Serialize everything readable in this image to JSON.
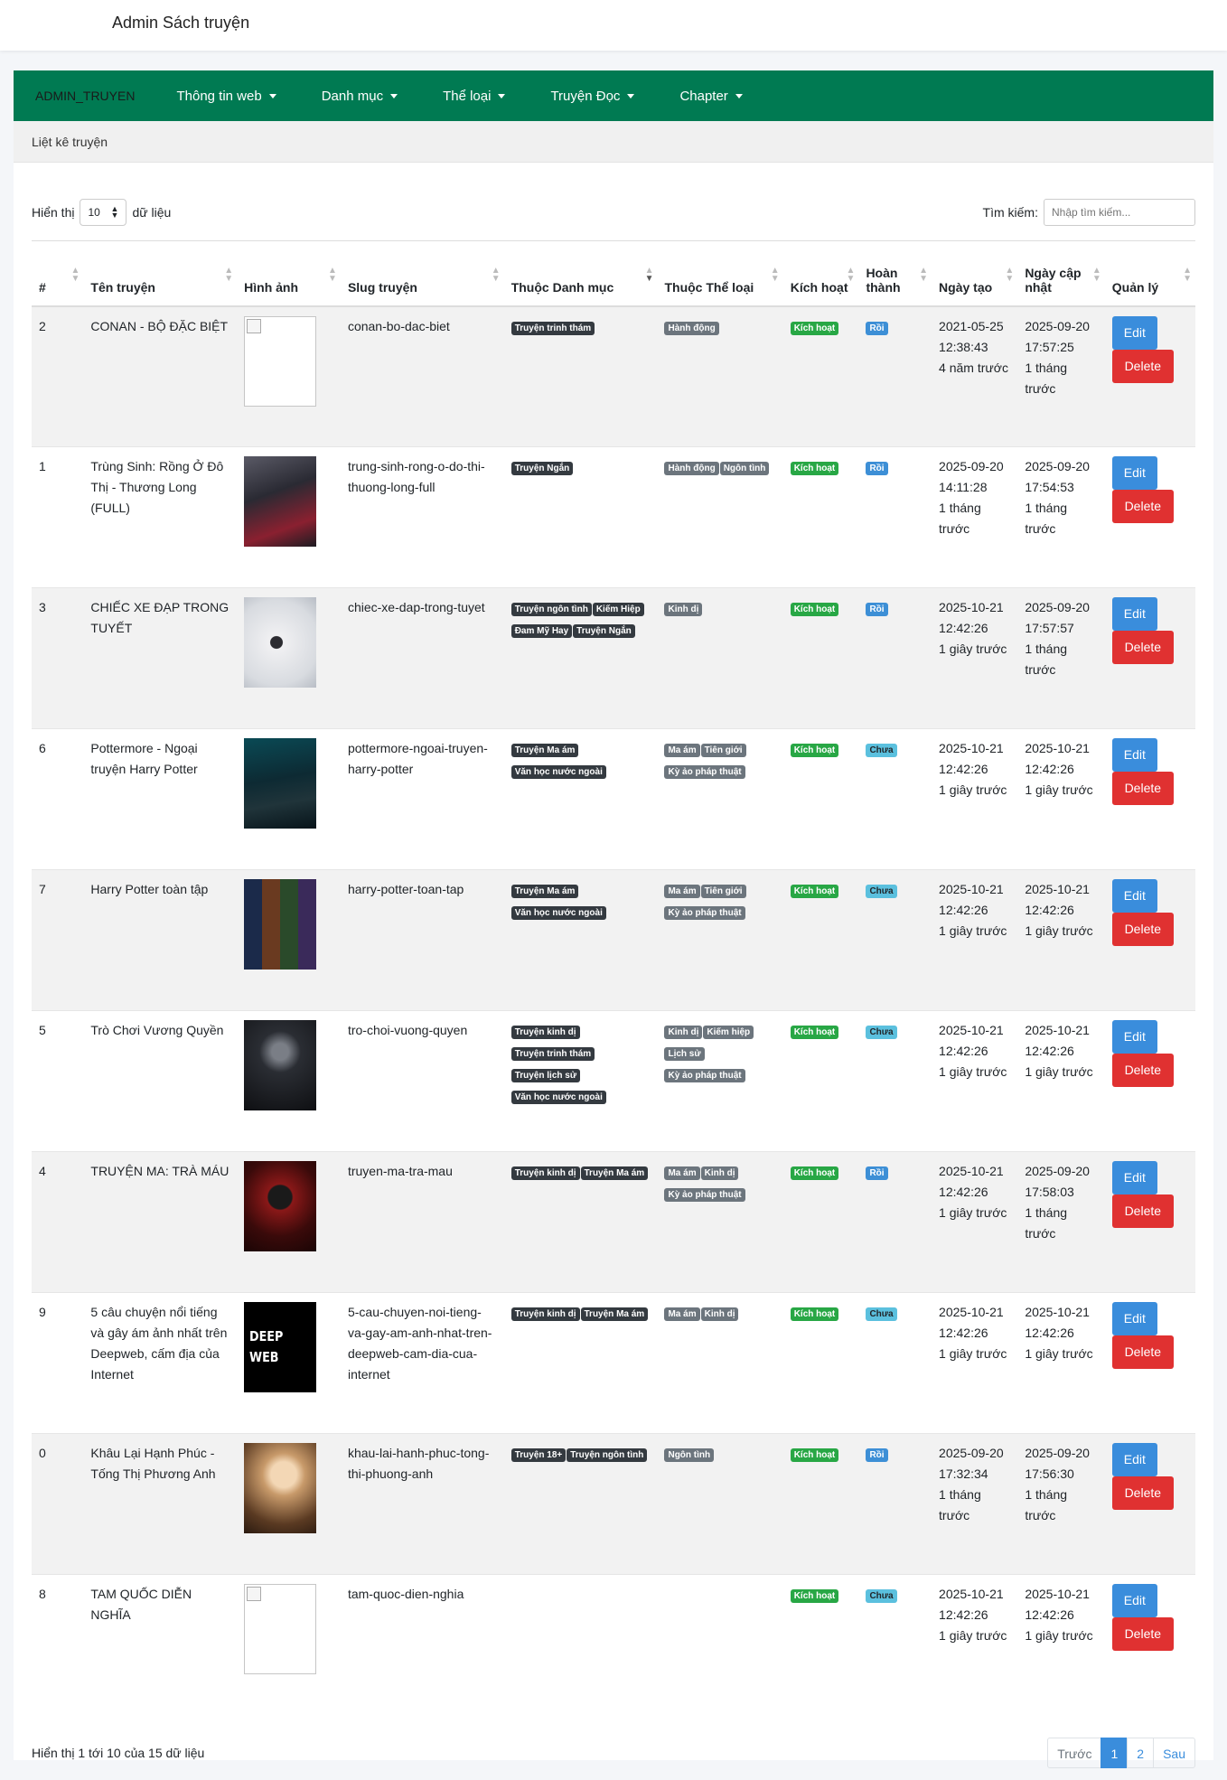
{
  "app": {
    "title": "Admin Sách truyện"
  },
  "nav": {
    "brand": "ADMIN_TRUYEN",
    "items": [
      "Thông tin web",
      "Danh mục",
      "Thể loại",
      "Truyện Đọc",
      "Chapter"
    ]
  },
  "breadcrumb": "Liệt kê truyện",
  "controls": {
    "show_prefix": "Hiển thị",
    "page_size": "10",
    "show_suffix": "dữ liệu",
    "search_label": "Tìm kiếm:",
    "search_placeholder": "Nhập tìm kiếm..."
  },
  "table": {
    "headers": [
      "#",
      "Tên truyện",
      "Hình ảnh",
      "Slug truyện",
      "Thuộc Danh mục",
      "Thuộc Thể loại",
      "Kích hoạt",
      "Hoàn thành",
      "Ngày tạo",
      "Ngày cập nhật",
      "Quản lý"
    ],
    "edit_label": "Edit",
    "delete_label": "Delete",
    "rows": [
      {
        "id": "2",
        "name": "CONAN - BỘ ĐẶC BIỆT",
        "image": "broken",
        "slug": "conan-bo-dac-biet",
        "categories": [
          "Truyện trinh thám"
        ],
        "genres": [
          "Hành động"
        ],
        "active": "Kích hoạt",
        "done": "Rồi",
        "created": "2021-05-25 12:38:43",
        "created_ago": "4 năm trước",
        "updated": "2025-09-20 17:57:25",
        "updated_ago": "1 tháng trước"
      },
      {
        "id": "1",
        "name": "Trùng Sinh: Rồng Ở Đô Thị - Thương Long (FULL)",
        "image": "dark-poster",
        "slug": "trung-sinh-rong-o-do-thi-thuong-long-full",
        "categories": [
          "Truyện Ngắn"
        ],
        "genres": [
          "Hành động",
          "Ngôn tình"
        ],
        "active": "Kích hoạt",
        "done": "Rồi",
        "created": "2025-09-20 14:11:28",
        "created_ago": "1 tháng trước",
        "updated": "2025-09-20 17:54:53",
        "updated_ago": "1 tháng trước"
      },
      {
        "id": "3",
        "name": "CHIẾC XE ĐẠP TRONG TUYẾT",
        "image": "snow-bike",
        "slug": "chiec-xe-dap-trong-tuyet",
        "categories": [
          "Truyện ngôn tình",
          "Kiếm Hiệp",
          "Đam Mỹ Hay",
          "Truyện Ngắn"
        ],
        "genres": [
          "Kinh dị"
        ],
        "active": "Kích hoạt",
        "done": "Rồi",
        "created": "2025-10-21 12:42:26",
        "created_ago": "1 giây trước",
        "updated": "2025-09-20 17:57:57",
        "updated_ago": "1 tháng trước"
      },
      {
        "id": "6",
        "name": "Pottermore - Ngoại truyện Harry Potter",
        "image": "teal-poster",
        "slug": "pottermore-ngoai-truyen-harry-potter",
        "categories": [
          "Truyện Ma ám",
          "Văn học nước ngoài"
        ],
        "genres": [
          "Ma ám",
          "Tiên giới",
          "Kỳ ảo pháp thuật"
        ],
        "active": "Kích hoạt",
        "done": "Chưa",
        "created": "2025-10-21 12:42:26",
        "created_ago": "1 giây trước",
        "updated": "2025-10-21 12:42:26",
        "updated_ago": "1 giây trước"
      },
      {
        "id": "7",
        "name": "Harry Potter toàn tập",
        "image": "collage",
        "slug": "harry-potter-toan-tap",
        "categories": [
          "Truyện Ma ám",
          "Văn học nước ngoài"
        ],
        "genres": [
          "Ma ám",
          "Tiên giới",
          "Kỳ ảo pháp thuật"
        ],
        "active": "Kích hoạt",
        "done": "Chưa",
        "created": "2025-10-21 12:42:26",
        "created_ago": "1 giây trước",
        "updated": "2025-10-21 12:42:26",
        "updated_ago": "1 giây trước"
      },
      {
        "id": "5",
        "name": "Trò Chơi Vương Quyền",
        "image": "throne",
        "slug": "tro-choi-vuong-quyen",
        "categories": [
          "Truyện kinh dị",
          "Truyện trinh thám",
          "Truyện lịch sử",
          "Văn học nước ngoài"
        ],
        "genres": [
          "Kinh dị",
          "Kiếm hiệp",
          "Lịch sử",
          "Kỳ ảo pháp thuật"
        ],
        "active": "Kích hoạt",
        "done": "Chưa",
        "created": "2025-10-21 12:42:26",
        "created_ago": "1 giây trước",
        "updated": "2025-10-21 12:42:26",
        "updated_ago": "1 giây trước"
      },
      {
        "id": "4",
        "name": "TRUYỆN MA: TRÀ MÁU",
        "image": "red-mask",
        "slug": "truyen-ma-tra-mau",
        "categories": [
          "Truyện kinh dị",
          "Truyện Ma ám"
        ],
        "genres": [
          "Ma ám",
          "Kinh dị",
          "Kỳ ảo pháp thuật"
        ],
        "active": "Kích hoạt",
        "done": "Rồi",
        "created": "2025-10-21 12:42:26",
        "created_ago": "1 giây trước",
        "updated": "2025-09-20 17:58:03",
        "updated_ago": "1 tháng trước"
      },
      {
        "id": "9",
        "name": "5 câu chuyện nổi tiếng và gây ám ảnh nhất trên Deepweb, cấm địa của Internet",
        "image": "deepweb",
        "image_text": "DEEP WEB",
        "slug": "5-cau-chuyen-noi-tieng-va-gay-am-anh-nhat-tren-deepweb-cam-dia-cua-internet",
        "categories": [
          "Truyện kinh dị",
          "Truyện Ma ám"
        ],
        "genres": [
          "Ma ám",
          "Kinh dị"
        ],
        "active": "Kích hoạt",
        "done": "Chưa",
        "created": "2025-10-21 12:42:26",
        "created_ago": "1 giây trước",
        "updated": "2025-10-21 12:42:26",
        "updated_ago": "1 giây trước"
      },
      {
        "id": "0",
        "name": "Khâu Lại Hạnh Phúc - Tống Thị Phương Anh",
        "image": "girl",
        "slug": "khau-lai-hanh-phuc-tong-thi-phuong-anh",
        "categories": [
          "Truyện 18+",
          "Truyện ngôn tình"
        ],
        "genres": [
          "Ngôn tình"
        ],
        "active": "Kích hoạt",
        "done": "Rồi",
        "created": "2025-09-20 17:32:34",
        "created_ago": "1 tháng trước",
        "updated": "2025-09-20 17:56:30",
        "updated_ago": "1 tháng trước"
      },
      {
        "id": "8",
        "name": "TAM QUỐC DIỄN NGHĨA",
        "image": "broken",
        "slug": "tam-quoc-dien-nghia",
        "categories": [],
        "genres": [],
        "active": "Kích hoạt",
        "done": "Chưa",
        "created": "2025-10-21 12:42:26",
        "created_ago": "1 giây trước",
        "updated": "2025-10-21 12:42:26",
        "updated_ago": "1 giây trước"
      }
    ]
  },
  "footer": {
    "info": "Hiển thị 1 tới 10 của 15 dữ liệu",
    "prev": "Trước",
    "pages": [
      "1",
      "2"
    ],
    "next": "Sau"
  },
  "colors": {
    "nav_bg": "#007a52",
    "edit": "#3a8ddc",
    "delete": "#e03131",
    "badge_active": "#28a745",
    "badge_done": "#3d8fd6",
    "badge_notdone": "#5bc0de"
  }
}
